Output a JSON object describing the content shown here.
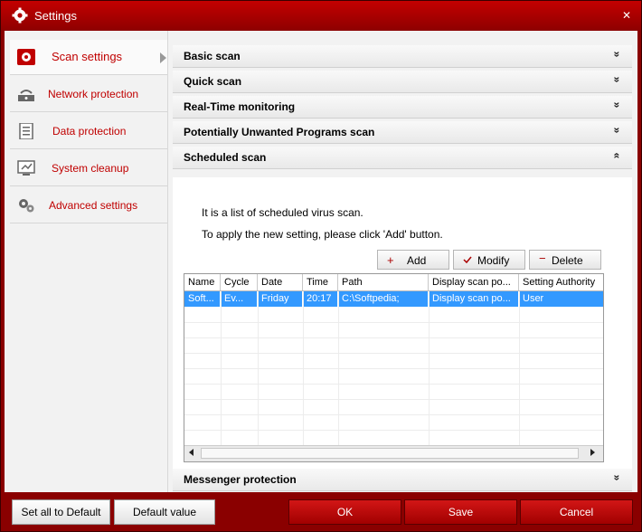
{
  "window": {
    "title": "Settings",
    "close_symbol": "✕"
  },
  "sidebar": {
    "items": [
      {
        "label": "Scan settings",
        "icon": "scan-settings-icon",
        "active": true
      },
      {
        "label": "Network protection",
        "icon": "network-icon"
      },
      {
        "label": "Data protection",
        "icon": "data-protection-icon"
      },
      {
        "label": "System cleanup",
        "icon": "system-cleanup-icon"
      },
      {
        "label": "Advanced settings",
        "icon": "advanced-settings-icon"
      }
    ]
  },
  "sections": {
    "basic": "Basic scan",
    "quick": "Quick scan",
    "realtime": "Real-Time monitoring",
    "pup": "Potentially Unwanted Programs scan",
    "scheduled": "Scheduled scan",
    "messenger": "Messenger protection",
    "chev_down": "»",
    "chev_up": "«"
  },
  "scheduled": {
    "line1": "It is a list of scheduled virus scan.",
    "line2": "To apply the new setting, please click 'Add' button.",
    "buttons": {
      "add": "Add",
      "modify": "Modify",
      "delete": "Delete"
    },
    "columns": [
      "Name",
      "Cycle",
      "Date",
      "Time",
      "Path",
      "Display scan po...",
      "Setting Authority"
    ],
    "rows": [
      [
        "Soft...",
        "Ev...",
        "Friday",
        "20:17",
        "C:\\Softpedia;",
        "Display scan po...",
        "User"
      ]
    ]
  },
  "footer": {
    "set_all_default": "Set all to Default",
    "default_value": "Default value",
    "ok": "OK",
    "save": "Save",
    "cancel": "Cancel"
  },
  "colors": {
    "accent": "#c00000",
    "titlebar": "#b00000",
    "selection": "#3399ff"
  }
}
